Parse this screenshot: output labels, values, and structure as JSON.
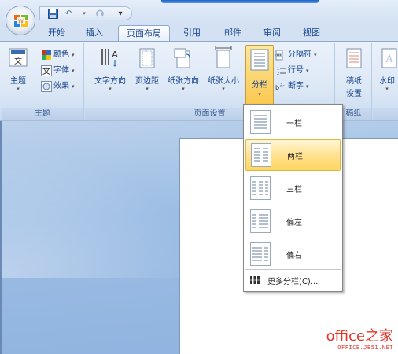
{
  "tabs": [
    {
      "id": "home",
      "label": "开始"
    },
    {
      "id": "insert",
      "label": "插入"
    },
    {
      "id": "page-layout",
      "label": "页面布局",
      "active": true
    },
    {
      "id": "references",
      "label": "引用"
    },
    {
      "id": "mailings",
      "label": "邮件"
    },
    {
      "id": "review",
      "label": "审阅"
    },
    {
      "id": "view",
      "label": "视图"
    }
  ],
  "qat": {
    "undo_glyph": "↶",
    "more_glyph": "▾"
  },
  "groups": {
    "themes": {
      "label": "主题",
      "theme_button": "主题",
      "colors": "颜色",
      "fonts": "字体",
      "effects": "效果"
    },
    "page_setup": {
      "label": "页面设置",
      "text_direction": "文字方向",
      "margins": "页边距",
      "orientation": "纸张方向",
      "size": "纸张大小",
      "columns": "分栏",
      "breaks": "分隔符",
      "line_numbers": "行号",
      "hyphenation": "断字"
    },
    "paper": {
      "label": "稿纸",
      "paper_settings_line1": "稿纸",
      "paper_settings_line2": "设置"
    },
    "background": {
      "watermark": "水印"
    }
  },
  "columns_menu": {
    "items": [
      {
        "id": "one",
        "label": "一栏"
      },
      {
        "id": "two",
        "label": "两栏",
        "highlighted": true
      },
      {
        "id": "three",
        "label": "三栏"
      },
      {
        "id": "left",
        "label": "偏左"
      },
      {
        "id": "right",
        "label": "偏右"
      }
    ],
    "more": "更多分栏(C)..."
  },
  "watermark": {
    "logo": "office之家",
    "url": "OFFICE.JB51.NET"
  },
  "colors": {
    "ribbon_text": "#15428b",
    "highlight": "#ffe08c",
    "brand_red": "#e2352a"
  }
}
